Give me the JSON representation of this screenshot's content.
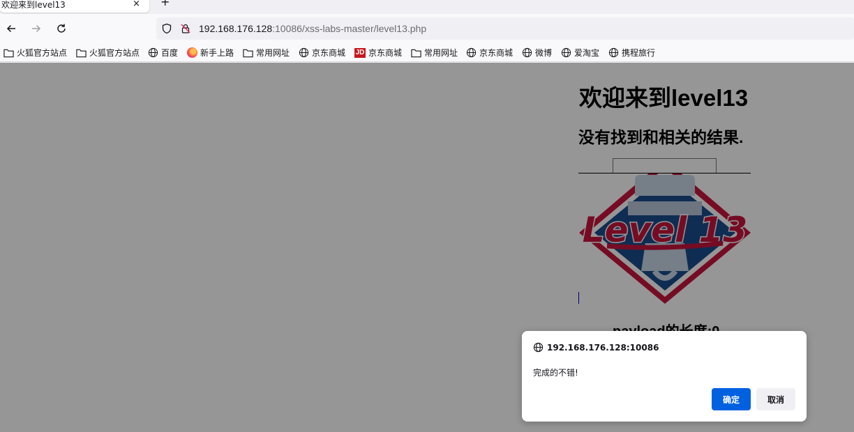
{
  "tab": {
    "title": "欢迎来到level13",
    "close": "×",
    "new_tab": "+"
  },
  "url": {
    "host": "192.168.176.128",
    "rest": ":10086/xss-labs-master/level13.php"
  },
  "bookmarks": [
    {
      "label": "火狐官方站点",
      "icon": "folder-icon"
    },
    {
      "label": "火狐官方站点",
      "icon": "folder-icon"
    },
    {
      "label": "百度",
      "icon": "globe-icon"
    },
    {
      "label": "新手上路",
      "icon": "firefox-icon"
    },
    {
      "label": "常用网址",
      "icon": "folder-icon"
    },
    {
      "label": "京东商城",
      "icon": "globe-icon"
    },
    {
      "label": "京东商城",
      "icon": "jd-icon"
    },
    {
      "label": "常用网址",
      "icon": "folder-icon"
    },
    {
      "label": "京东商城",
      "icon": "globe-icon"
    },
    {
      "label": "微博",
      "icon": "globe-icon"
    },
    {
      "label": "爱淘宝",
      "icon": "globe-icon"
    },
    {
      "label": "携程旅行",
      "icon": "globe-icon"
    }
  ],
  "jd_icon_text": "JD",
  "page": {
    "heading": "欢迎来到level13",
    "subheading": "没有找到和相关的结果.",
    "payload_text": "payload的长度:0",
    "logo_text": "Level 13"
  },
  "dialog": {
    "origin": "192.168.176.128:10086",
    "message": "完成的不错!",
    "ok_label": "确定",
    "cancel_label": "取消"
  },
  "colors": {
    "overlay": "#969698",
    "accent_button": "#0061e0",
    "logo_red": "#c8163e",
    "logo_blue": "#1a4d8c"
  }
}
